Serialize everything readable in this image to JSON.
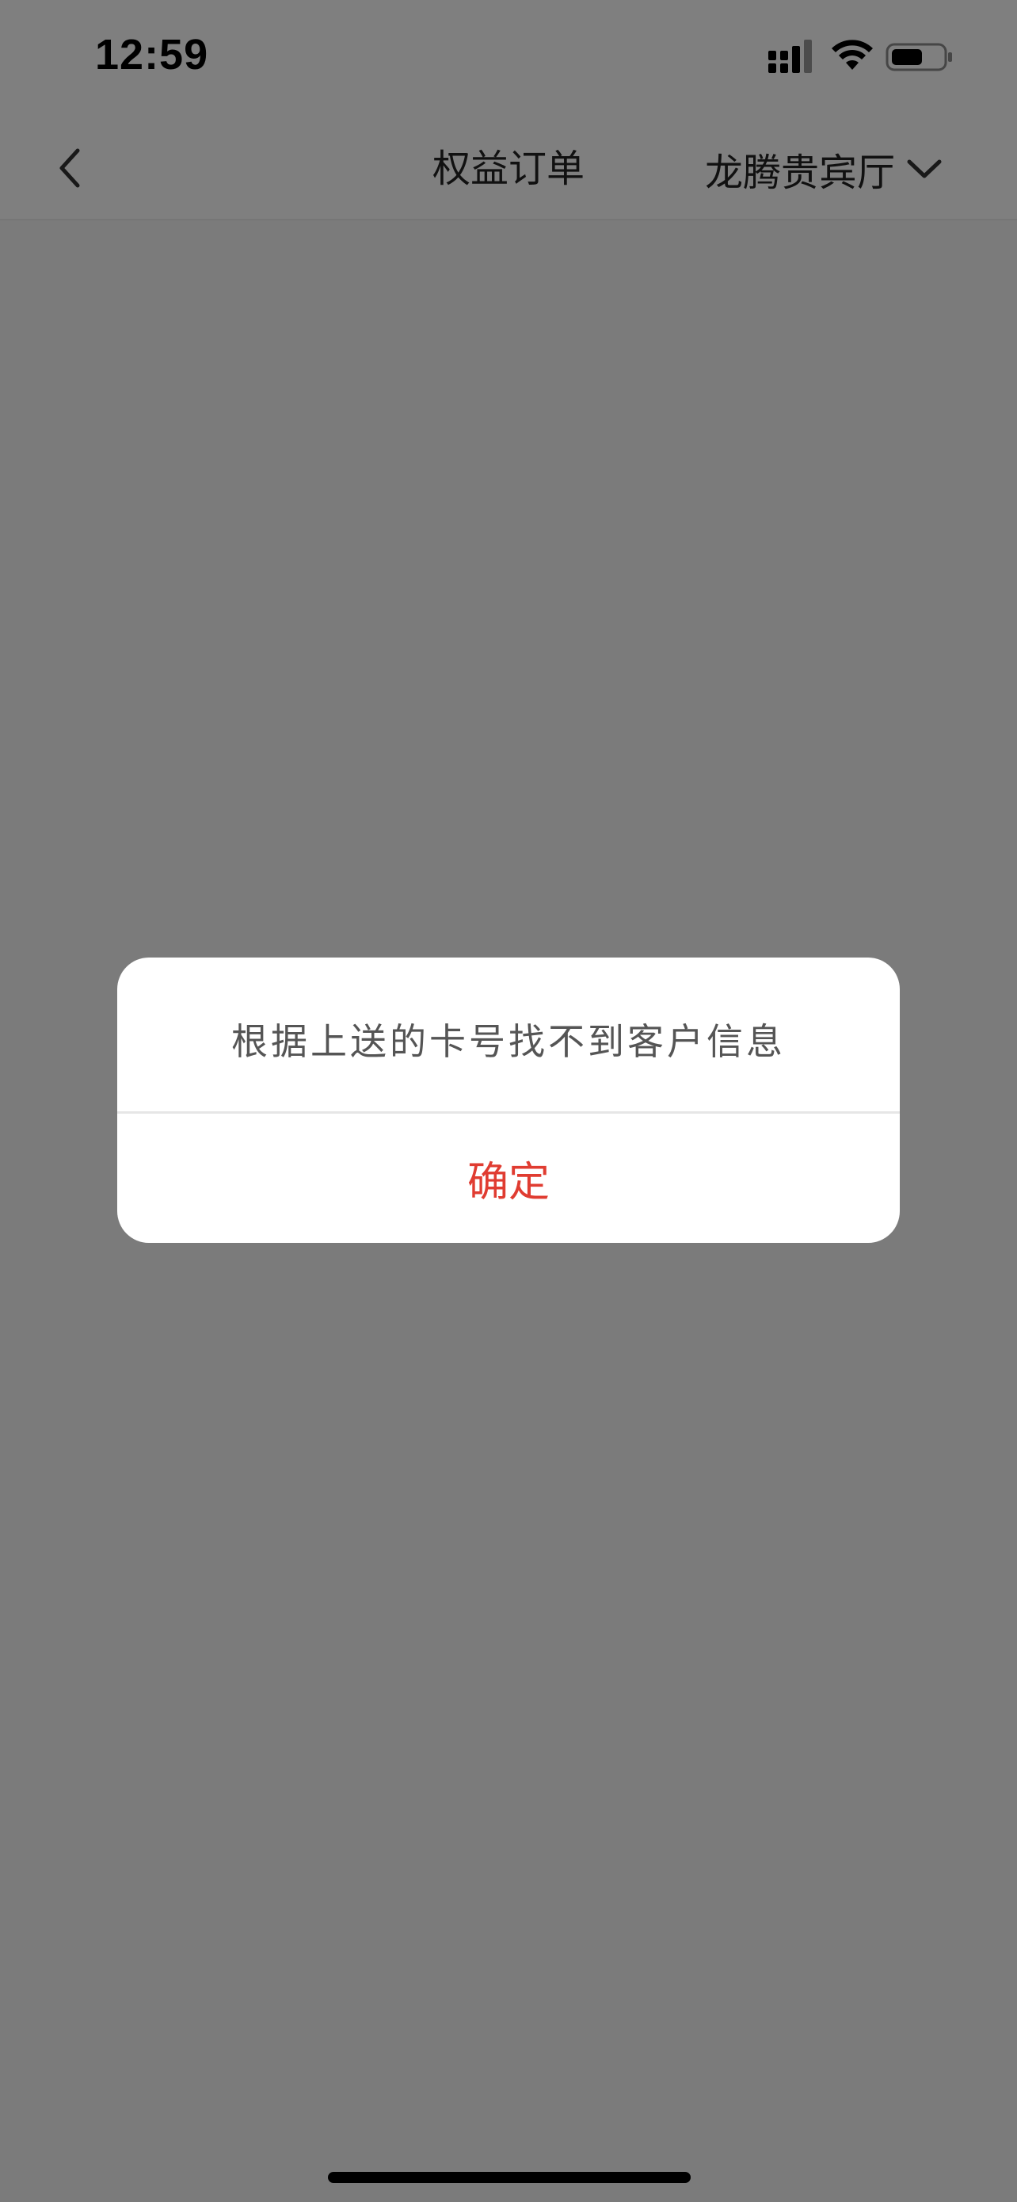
{
  "status_bar": {
    "time": "12:59",
    "icons": [
      "signal-icon",
      "wifi-icon",
      "battery-icon"
    ]
  },
  "nav_bar": {
    "back_icon": "chevron-left-icon",
    "title": "权益订单",
    "location": "龙腾贵宾厅",
    "location_icon": "chevron-down-icon"
  },
  "dialog": {
    "message": "根据上送的卡号找不到客户信息",
    "confirm_label": "确定"
  },
  "colors": {
    "accent": "#e03c31",
    "overlay": "#7a7a7a",
    "text": "#222222"
  }
}
